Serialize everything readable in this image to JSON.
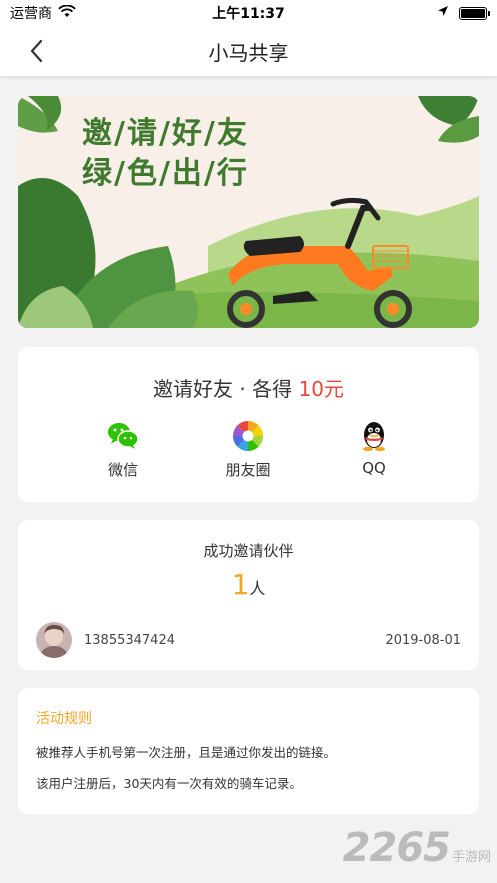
{
  "status_bar": {
    "carrier": "运营商",
    "time": "上午11:37"
  },
  "nav": {
    "title": "小马共享"
  },
  "banner": {
    "line1": "邀/请/好/友",
    "line2": "绿/色/出/行"
  },
  "invite": {
    "title_prefix": "邀请好友 · 各得 ",
    "amount": "10元",
    "amount_color": "#e8473b",
    "share_options": [
      {
        "label": "微信",
        "icon": "wechat-icon"
      },
      {
        "label": "朋友圈",
        "icon": "moments-icon"
      },
      {
        "label": "QQ",
        "icon": "qq-icon"
      }
    ]
  },
  "success": {
    "title": "成功邀请伙伴",
    "count": "1",
    "unit": "人",
    "count_color": "#f5a623",
    "partners": [
      {
        "phone": "13855347424",
        "date": "2019-08-01"
      }
    ]
  },
  "rules": {
    "title": "活动规则",
    "title_color": "#f5a623",
    "items": [
      "被推荐人手机号第一次注册，且是通过你发出的链接。",
      "该用户注册后，30天内有一次有效的骑车记录。"
    ]
  },
  "watermark": {
    "big": "2265",
    "sub": "手游网"
  }
}
